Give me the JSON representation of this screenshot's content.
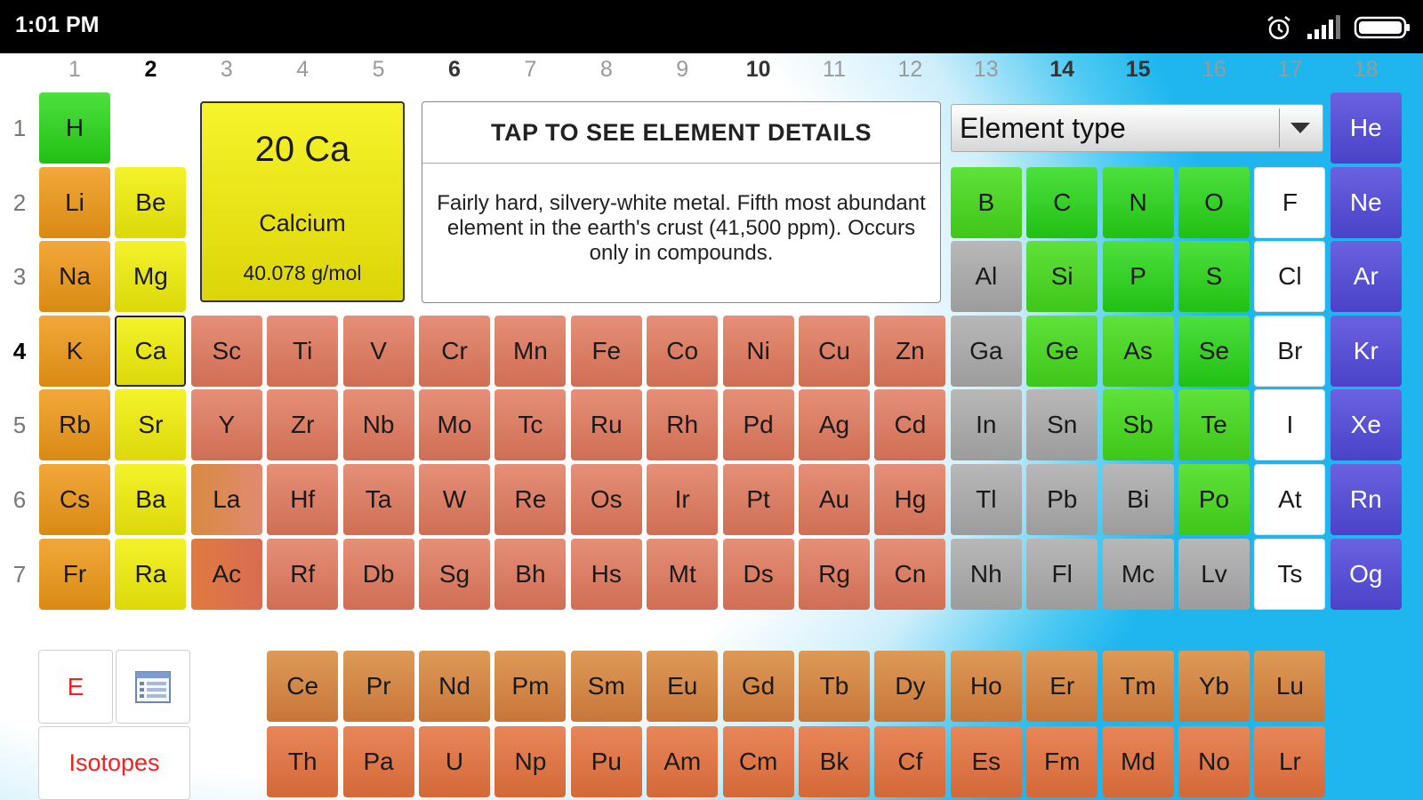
{
  "status": {
    "time": "1:01 PM"
  },
  "group_numbers": [
    "1",
    "2",
    "3",
    "4",
    "5",
    "6",
    "7",
    "8",
    "9",
    "10",
    "11",
    "12",
    "13",
    "14",
    "15",
    "16",
    "17",
    "18"
  ],
  "period_numbers": [
    "1",
    "2",
    "3",
    "4",
    "5",
    "6",
    "7"
  ],
  "selected_element": {
    "number_symbol": "20 Ca",
    "name": "Calcium",
    "mass": "40.078 g/mol"
  },
  "details": {
    "header": "TAP TO SEE ELEMENT DETAILS",
    "description": "Fairly hard, silvery-white metal. Fifth most abundant element in the earth's crust (41,500 ppm). Occurs only in compounds."
  },
  "filter": {
    "label": "Element type"
  },
  "buttons": {
    "e_label": "E",
    "isotopes_label": "Isotopes"
  },
  "elements": [
    {
      "s": "H",
      "g": 1,
      "p": 1,
      "c": "nonmetal"
    },
    {
      "s": "He",
      "g": 18,
      "p": 1,
      "c": "noble"
    },
    {
      "s": "Li",
      "g": 1,
      "p": 2,
      "c": "alkali"
    },
    {
      "s": "Be",
      "g": 2,
      "p": 2,
      "c": "alkaline"
    },
    {
      "s": "B",
      "g": 13,
      "p": 2,
      "c": "metalloid"
    },
    {
      "s": "C",
      "g": 14,
      "p": 2,
      "c": "nonmetal"
    },
    {
      "s": "N",
      "g": 15,
      "p": 2,
      "c": "nonmetal"
    },
    {
      "s": "O",
      "g": 16,
      "p": 2,
      "c": "nonmetal"
    },
    {
      "s": "F",
      "g": 17,
      "p": 2,
      "c": "halogen"
    },
    {
      "s": "Ne",
      "g": 18,
      "p": 2,
      "c": "noble"
    },
    {
      "s": "Na",
      "g": 1,
      "p": 3,
      "c": "alkali"
    },
    {
      "s": "Mg",
      "g": 2,
      "p": 3,
      "c": "alkaline"
    },
    {
      "s": "Al",
      "g": 13,
      "p": 3,
      "c": "metal"
    },
    {
      "s": "Si",
      "g": 14,
      "p": 3,
      "c": "metalloid"
    },
    {
      "s": "P",
      "g": 15,
      "p": 3,
      "c": "nonmetal"
    },
    {
      "s": "S",
      "g": 16,
      "p": 3,
      "c": "nonmetal"
    },
    {
      "s": "Cl",
      "g": 17,
      "p": 3,
      "c": "halogen"
    },
    {
      "s": "Ar",
      "g": 18,
      "p": 3,
      "c": "noble"
    },
    {
      "s": "K",
      "g": 1,
      "p": 4,
      "c": "alkali"
    },
    {
      "s": "Ca",
      "g": 2,
      "p": 4,
      "c": "alkaline",
      "sel": true
    },
    {
      "s": "Sc",
      "g": 3,
      "p": 4,
      "c": "transition"
    },
    {
      "s": "Ti",
      "g": 4,
      "p": 4,
      "c": "transition"
    },
    {
      "s": "V",
      "g": 5,
      "p": 4,
      "c": "transition"
    },
    {
      "s": "Cr",
      "g": 6,
      "p": 4,
      "c": "transition"
    },
    {
      "s": "Mn",
      "g": 7,
      "p": 4,
      "c": "transition"
    },
    {
      "s": "Fe",
      "g": 8,
      "p": 4,
      "c": "transition"
    },
    {
      "s": "Co",
      "g": 9,
      "p": 4,
      "c": "transition"
    },
    {
      "s": "Ni",
      "g": 10,
      "p": 4,
      "c": "transition"
    },
    {
      "s": "Cu",
      "g": 11,
      "p": 4,
      "c": "transition"
    },
    {
      "s": "Zn",
      "g": 12,
      "p": 4,
      "c": "transition"
    },
    {
      "s": "Ga",
      "g": 13,
      "p": 4,
      "c": "metal"
    },
    {
      "s": "Ge",
      "g": 14,
      "p": 4,
      "c": "metalloid"
    },
    {
      "s": "As",
      "g": 15,
      "p": 4,
      "c": "metalloid"
    },
    {
      "s": "Se",
      "g": 16,
      "p": 4,
      "c": "nonmetal"
    },
    {
      "s": "Br",
      "g": 17,
      "p": 4,
      "c": "halogen"
    },
    {
      "s": "Kr",
      "g": 18,
      "p": 4,
      "c": "noble"
    },
    {
      "s": "Rb",
      "g": 1,
      "p": 5,
      "c": "alkali"
    },
    {
      "s": "Sr",
      "g": 2,
      "p": 5,
      "c": "alkaline"
    },
    {
      "s": "Y",
      "g": 3,
      "p": 5,
      "c": "transition"
    },
    {
      "s": "Zr",
      "g": 4,
      "p": 5,
      "c": "transition"
    },
    {
      "s": "Nb",
      "g": 5,
      "p": 5,
      "c": "transition"
    },
    {
      "s": "Mo",
      "g": 6,
      "p": 5,
      "c": "transition"
    },
    {
      "s": "Tc",
      "g": 7,
      "p": 5,
      "c": "transition"
    },
    {
      "s": "Ru",
      "g": 8,
      "p": 5,
      "c": "transition"
    },
    {
      "s": "Rh",
      "g": 9,
      "p": 5,
      "c": "transition"
    },
    {
      "s": "Pd",
      "g": 10,
      "p": 5,
      "c": "transition"
    },
    {
      "s": "Ag",
      "g": 11,
      "p": 5,
      "c": "transition"
    },
    {
      "s": "Cd",
      "g": 12,
      "p": 5,
      "c": "transition"
    },
    {
      "s": "In",
      "g": 13,
      "p": 5,
      "c": "metal"
    },
    {
      "s": "Sn",
      "g": 14,
      "p": 5,
      "c": "metal"
    },
    {
      "s": "Sb",
      "g": 15,
      "p": 5,
      "c": "metalloid"
    },
    {
      "s": "Te",
      "g": 16,
      "p": 5,
      "c": "metalloid"
    },
    {
      "s": "I",
      "g": 17,
      "p": 5,
      "c": "halogen"
    },
    {
      "s": "Xe",
      "g": 18,
      "p": 5,
      "c": "noble"
    },
    {
      "s": "Cs",
      "g": 1,
      "p": 6,
      "c": "alkali"
    },
    {
      "s": "Ba",
      "g": 2,
      "p": 6,
      "c": "alkaline"
    },
    {
      "s": "La",
      "g": 3,
      "p": 6,
      "c": "la"
    },
    {
      "s": "Hf",
      "g": 4,
      "p": 6,
      "c": "transition"
    },
    {
      "s": "Ta",
      "g": 5,
      "p": 6,
      "c": "transition"
    },
    {
      "s": "W",
      "g": 6,
      "p": 6,
      "c": "transition"
    },
    {
      "s": "Re",
      "g": 7,
      "p": 6,
      "c": "transition"
    },
    {
      "s": "Os",
      "g": 8,
      "p": 6,
      "c": "transition"
    },
    {
      "s": "Ir",
      "g": 9,
      "p": 6,
      "c": "transition"
    },
    {
      "s": "Pt",
      "g": 10,
      "p": 6,
      "c": "transition"
    },
    {
      "s": "Au",
      "g": 11,
      "p": 6,
      "c": "transition"
    },
    {
      "s": "Hg",
      "g": 12,
      "p": 6,
      "c": "transition"
    },
    {
      "s": "Tl",
      "g": 13,
      "p": 6,
      "c": "metal"
    },
    {
      "s": "Pb",
      "g": 14,
      "p": 6,
      "c": "metal"
    },
    {
      "s": "Bi",
      "g": 15,
      "p": 6,
      "c": "metal"
    },
    {
      "s": "Po",
      "g": 16,
      "p": 6,
      "c": "metalloid"
    },
    {
      "s": "At",
      "g": 17,
      "p": 6,
      "c": "halogen"
    },
    {
      "s": "Rn",
      "g": 18,
      "p": 6,
      "c": "noble"
    },
    {
      "s": "Fr",
      "g": 1,
      "p": 7,
      "c": "alkali"
    },
    {
      "s": "Ra",
      "g": 2,
      "p": 7,
      "c": "alkaline"
    },
    {
      "s": "Ac",
      "g": 3,
      "p": 7,
      "c": "ac"
    },
    {
      "s": "Rf",
      "g": 4,
      "p": 7,
      "c": "transition"
    },
    {
      "s": "Db",
      "g": 5,
      "p": 7,
      "c": "transition"
    },
    {
      "s": "Sg",
      "g": 6,
      "p": 7,
      "c": "transition"
    },
    {
      "s": "Bh",
      "g": 7,
      "p": 7,
      "c": "transition"
    },
    {
      "s": "Hs",
      "g": 8,
      "p": 7,
      "c": "transition"
    },
    {
      "s": "Mt",
      "g": 9,
      "p": 7,
      "c": "transition"
    },
    {
      "s": "Ds",
      "g": 10,
      "p": 7,
      "c": "transition"
    },
    {
      "s": "Rg",
      "g": 11,
      "p": 7,
      "c": "transition"
    },
    {
      "s": "Cn",
      "g": 12,
      "p": 7,
      "c": "transition"
    },
    {
      "s": "Nh",
      "g": 13,
      "p": 7,
      "c": "metal"
    },
    {
      "s": "Fl",
      "g": 14,
      "p": 7,
      "c": "metal"
    },
    {
      "s": "Mc",
      "g": 15,
      "p": 7,
      "c": "metal"
    },
    {
      "s": "Lv",
      "g": 16,
      "p": 7,
      "c": "metal"
    },
    {
      "s": "Ts",
      "g": 17,
      "p": 7,
      "c": "halogen"
    },
    {
      "s": "Og",
      "g": 18,
      "p": 7,
      "c": "noble"
    }
  ],
  "lanthanides": [
    "Ce",
    "Pr",
    "Nd",
    "Pm",
    "Sm",
    "Eu",
    "Gd",
    "Tb",
    "Dy",
    "Ho",
    "Er",
    "Tm",
    "Yb",
    "Lu"
  ],
  "actinides": [
    "Th",
    "Pa",
    "U",
    "Np",
    "Pu",
    "Am",
    "Cm",
    "Bk",
    "Cf",
    "Es",
    "Fm",
    "Md",
    "No",
    "Lr"
  ]
}
